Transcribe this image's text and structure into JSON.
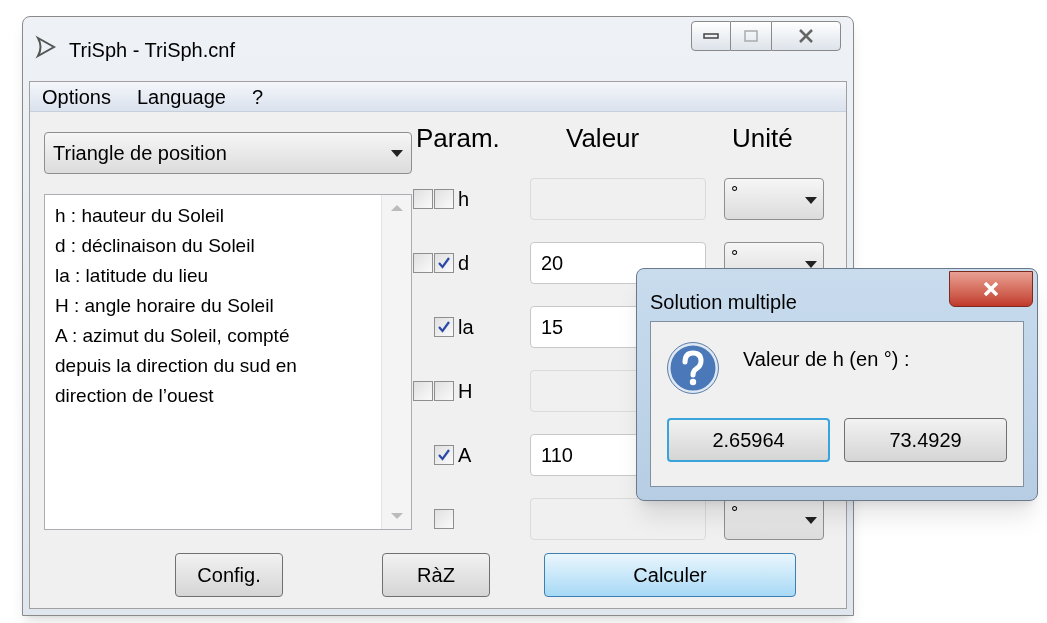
{
  "window": {
    "title": "TriSph - TriSph.cnf"
  },
  "menu": [
    {
      "label": "Options"
    },
    {
      "label": "Language"
    },
    {
      "label": "?"
    }
  ],
  "triangle_select": {
    "value": "Triangle de position"
  },
  "description": [
    "h : hauteur du Soleil",
    "d : déclinaison du Soleil",
    "la : latitude du lieu",
    "H : angle horaire du Soleil",
    "A : azimut du Soleil, compté",
    "depuis la direction du sud en",
    "direction de l’ouest"
  ],
  "columns": [
    "Param.",
    "Valeur",
    "Unité"
  ],
  "params": [
    {
      "checkboxes": [
        {
          "checked": false
        },
        {
          "checked": false
        }
      ],
      "label": "h",
      "unit": "°"
    },
    {
      "checkboxes": [
        {
          "checked": false
        },
        {
          "checked": true
        }
      ],
      "label": "d",
      "value": "20",
      "unit": "°"
    },
    {
      "checkboxes": [
        {
          "checked": true
        }
      ],
      "label": "la",
      "value": "15"
    },
    {
      "checkboxes": [
        {
          "checked": false
        },
        {
          "checked": false
        }
      ],
      "label": "H"
    },
    {
      "checkboxes": [
        {
          "checked": true
        }
      ],
      "label": "A",
      "value": "110"
    },
    {
      "checkboxes": [
        {
          "checked": false
        }
      ],
      "unit": "°"
    }
  ],
  "buttons": [
    {
      "label": "Config.",
      "default": false
    },
    {
      "label": "RàZ",
      "default": false
    },
    {
      "label": "Calculer",
      "default": true
    }
  ],
  "dialog": {
    "title": "Solution multiple",
    "message": "Valeur de h (en °) :",
    "buttons": [
      {
        "label": "2.65964",
        "focused": true
      },
      {
        "label": "73.4929",
        "focused": false
      }
    ]
  }
}
